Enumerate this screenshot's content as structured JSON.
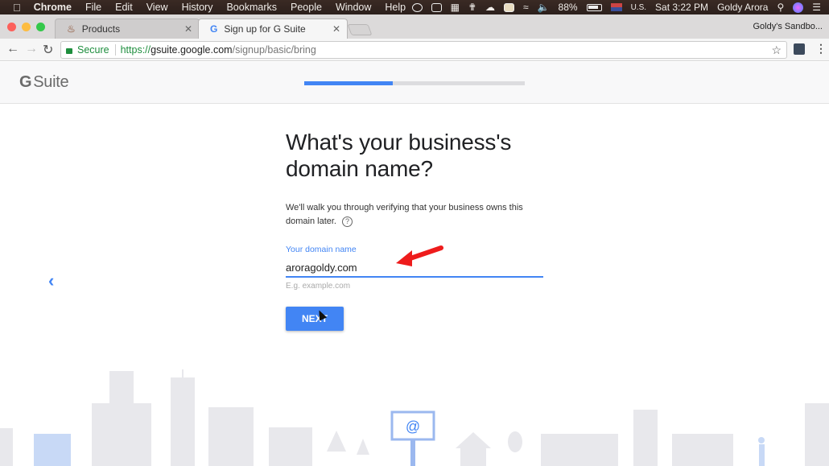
{
  "menubar": {
    "app": "Chrome",
    "items": [
      "File",
      "Edit",
      "View",
      "History",
      "Bookmarks",
      "People",
      "Window",
      "Help"
    ],
    "battery": "88%",
    "input_source": "U.S.",
    "clock": "Sat 3:22 PM",
    "user": "Goldy Arora",
    "icons": [
      "check-circle-icon",
      "video-icon",
      "tiles-icon",
      "tool-icon",
      "cloud-icon",
      "display-icon",
      "wifi-icon",
      "volume-icon",
      "battery-icon",
      "flag-icon",
      "spotlight-icon",
      "siri-icon",
      "notification-list-icon"
    ]
  },
  "browser": {
    "tabs": [
      {
        "label": "Products",
        "icon": "products-favicon",
        "active": false
      },
      {
        "label": "Sign up for G Suite",
        "icon": "google-g-icon",
        "active": true
      }
    ],
    "profile": "Goldy's Sandbo...",
    "address": {
      "secure_label": "Secure",
      "scheme": "https://",
      "host": "gsuite.google.com",
      "path": "/signup/basic/bring"
    }
  },
  "page": {
    "logo": {
      "g": "G",
      "suite": "Suite"
    },
    "progress_percent": 40,
    "title": "What's your business's domain name?",
    "description": "We'll walk you through verifying that your business owns this domain later.",
    "help_icon": "?",
    "field": {
      "label": "Your domain name",
      "value": "aroragoldy.com",
      "hint": "E.g. example.com"
    },
    "next_label": "NEXT",
    "back_icon": "‹",
    "colors": {
      "accent": "#4285f4",
      "annotation": "#ee1c1c"
    }
  }
}
